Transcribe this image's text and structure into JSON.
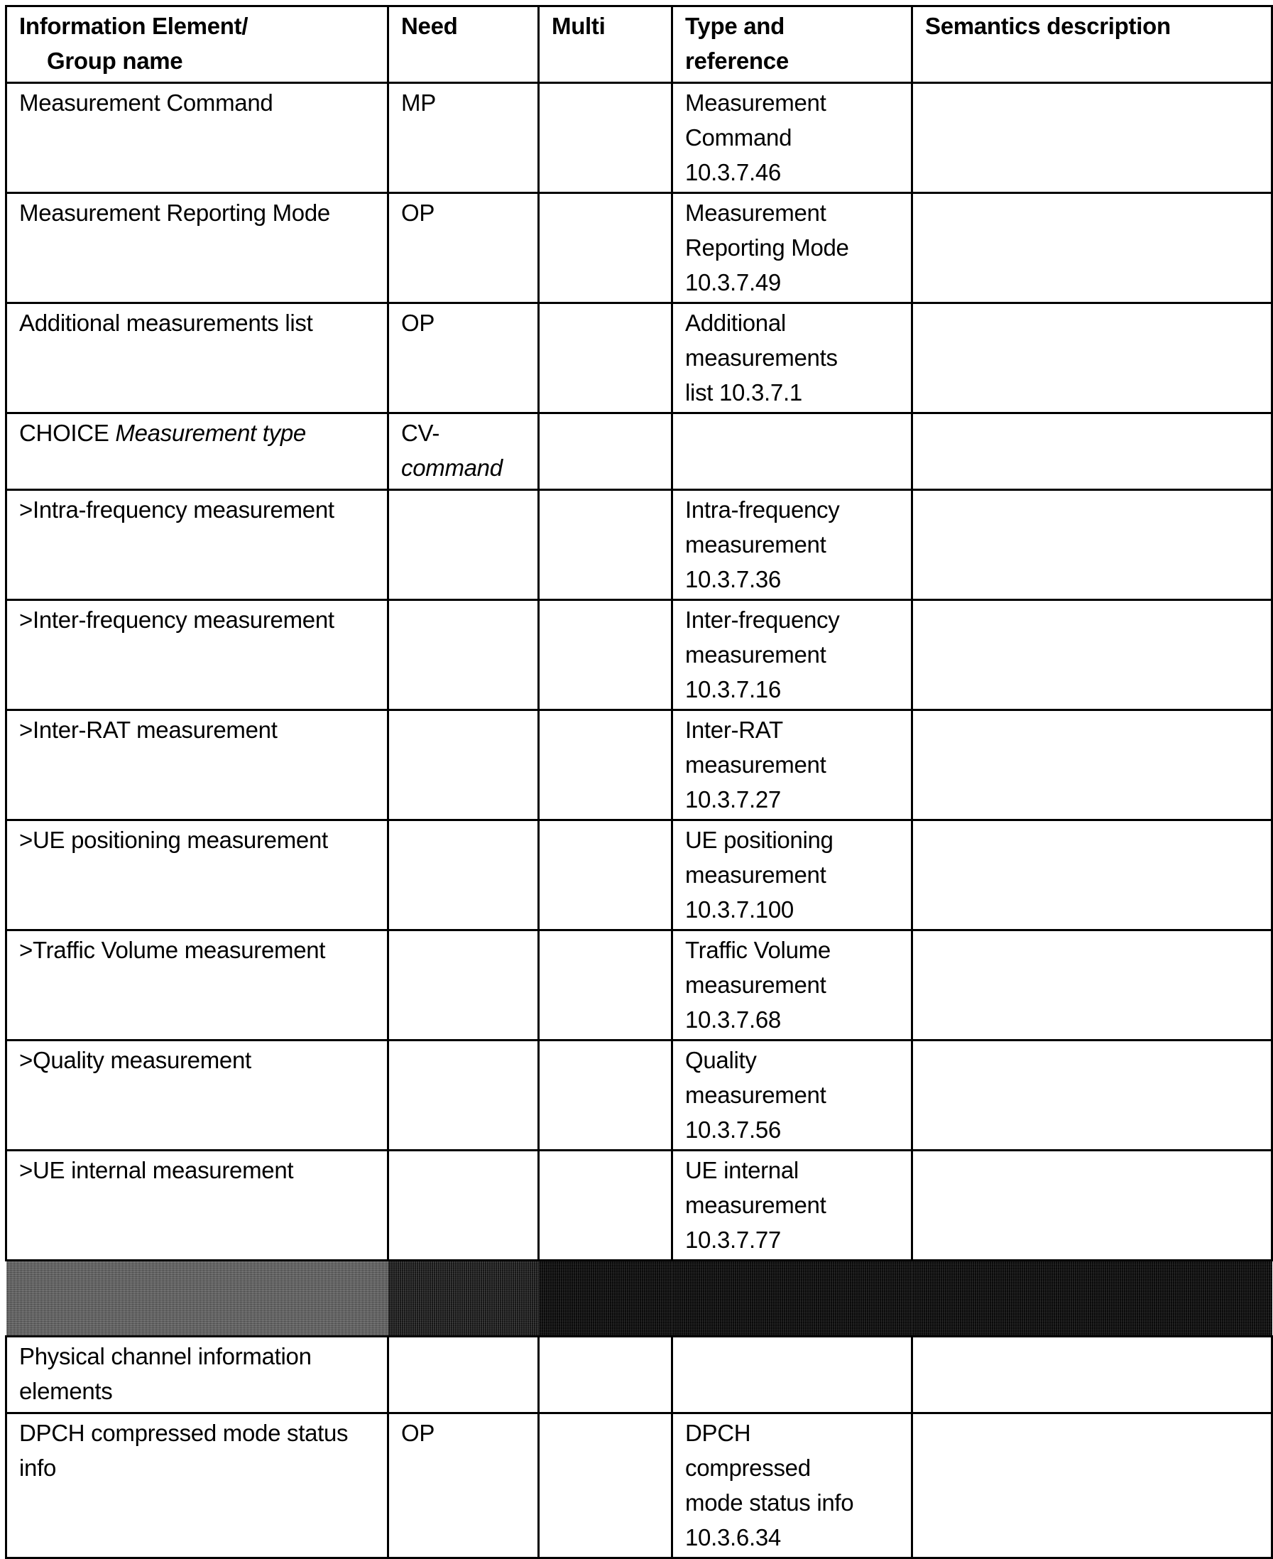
{
  "table": {
    "headers": {
      "element_line1": "Information Element/",
      "element_line2": "Group name",
      "need": "Need",
      "multi": "Multi",
      "type_line1": "Type and",
      "type_line2": "reference",
      "semantics": "Semantics description"
    },
    "rows": [
      {
        "element": "Measurement Command",
        "need": "MP",
        "multi": "",
        "type_lines": [
          "Measurement",
          "Command",
          "10.3.7.46"
        ],
        "semantics": ""
      },
      {
        "element": "Measurement Reporting Mode",
        "need": "OP",
        "multi": "",
        "type_lines": [
          "Measurement",
          "Reporting Mode",
          "10.3.7.49"
        ],
        "semantics": ""
      },
      {
        "element": "Additional measurements list",
        "need": "OP",
        "multi": "",
        "type_lines": [
          "Additional",
          "measurements",
          "list 10.3.7.1"
        ],
        "semantics": ""
      },
      {
        "element_prefix": "CHOICE ",
        "element_italic": "Measurement type",
        "need_line1": "CV-",
        "need_line2_italic": "command",
        "multi": "",
        "type_lines": [],
        "semantics": ""
      },
      {
        "element": ">Intra-frequency measurement",
        "need": "",
        "multi": "",
        "type_lines": [
          "Intra-frequency",
          "measurement",
          "10.3.7.36"
        ],
        "semantics": ""
      },
      {
        "element": ">Inter-frequency measurement",
        "need": "",
        "multi": "",
        "type_lines": [
          "Inter-frequency",
          "measurement",
          "10.3.7.16"
        ],
        "semantics": ""
      },
      {
        "element": ">Inter-RAT measurement",
        "need": "",
        "multi": "",
        "type_lines": [
          "Inter-RAT",
          "measurement",
          "10.3.7.27"
        ],
        "semantics": ""
      },
      {
        "element": ">UE positioning measurement",
        "need": "",
        "multi": "",
        "type_lines": [
          "UE positioning",
          "measurement",
          "10.3.7.100"
        ],
        "semantics": ""
      },
      {
        "element": ">Traffic Volume measurement",
        "need": "",
        "multi": "",
        "type_lines": [
          "Traffic Volume",
          "measurement",
          "10.3.7.68"
        ],
        "semantics": ""
      },
      {
        "element": ">Quality measurement",
        "need": "",
        "multi": "",
        "type_lines": [
          "Quality",
          "measurement",
          "10.3.7.56"
        ],
        "semantics": ""
      },
      {
        "element": ">UE internal measurement",
        "need": "",
        "multi": "",
        "type_lines": [
          "UE internal",
          "measurement",
          "10.3.7.77"
        ],
        "semantics": ""
      },
      {
        "redacted": true,
        "note": "illegible (obscured in scan)"
      },
      {
        "element_bold": "Physical channel information elements",
        "need": "",
        "multi": "",
        "type_lines": [],
        "semantics": ""
      },
      {
        "element": "DPCH compressed mode status info",
        "need": "OP",
        "multi": "",
        "type_lines": [
          "DPCH",
          "compressed",
          "mode status info",
          "10.3.6.34"
        ],
        "semantics": ""
      }
    ]
  }
}
